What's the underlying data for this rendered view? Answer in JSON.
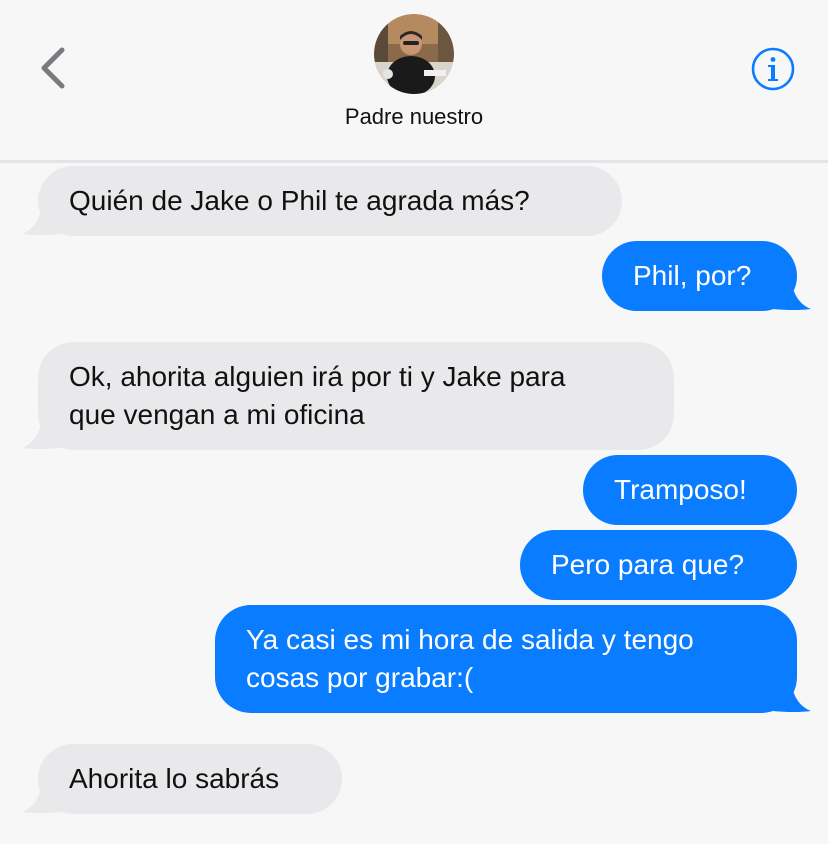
{
  "header": {
    "contact_name": "Padre nuestro",
    "back_icon": "chevron-left-icon",
    "info_icon": "info-icon",
    "accent_color": "#0a7cff"
  },
  "messages": [
    {
      "direction": "incoming",
      "text": "Quién de Jake o Phil te agrada más?"
    },
    {
      "direction": "outgoing",
      "text": "Phil, por?"
    },
    {
      "direction": "incoming",
      "lines": [
        "Ok, ahorita alguien irá por ti y Jake para",
        "que vengan a mi oficina"
      ]
    },
    {
      "direction": "outgoing",
      "text": "Tramposo!"
    },
    {
      "direction": "outgoing",
      "text": "Pero para que?"
    },
    {
      "direction": "outgoing",
      "lines": [
        "Ya casi es mi hora de salida y tengo",
        "cosas por grabar:("
      ]
    },
    {
      "direction": "incoming",
      "text": "Ahorita lo sabrás"
    }
  ],
  "colors": {
    "incoming_bubble": "#e9e9eb",
    "outgoing_bubble": "#0a7cff",
    "background": "#f7f7f8"
  }
}
